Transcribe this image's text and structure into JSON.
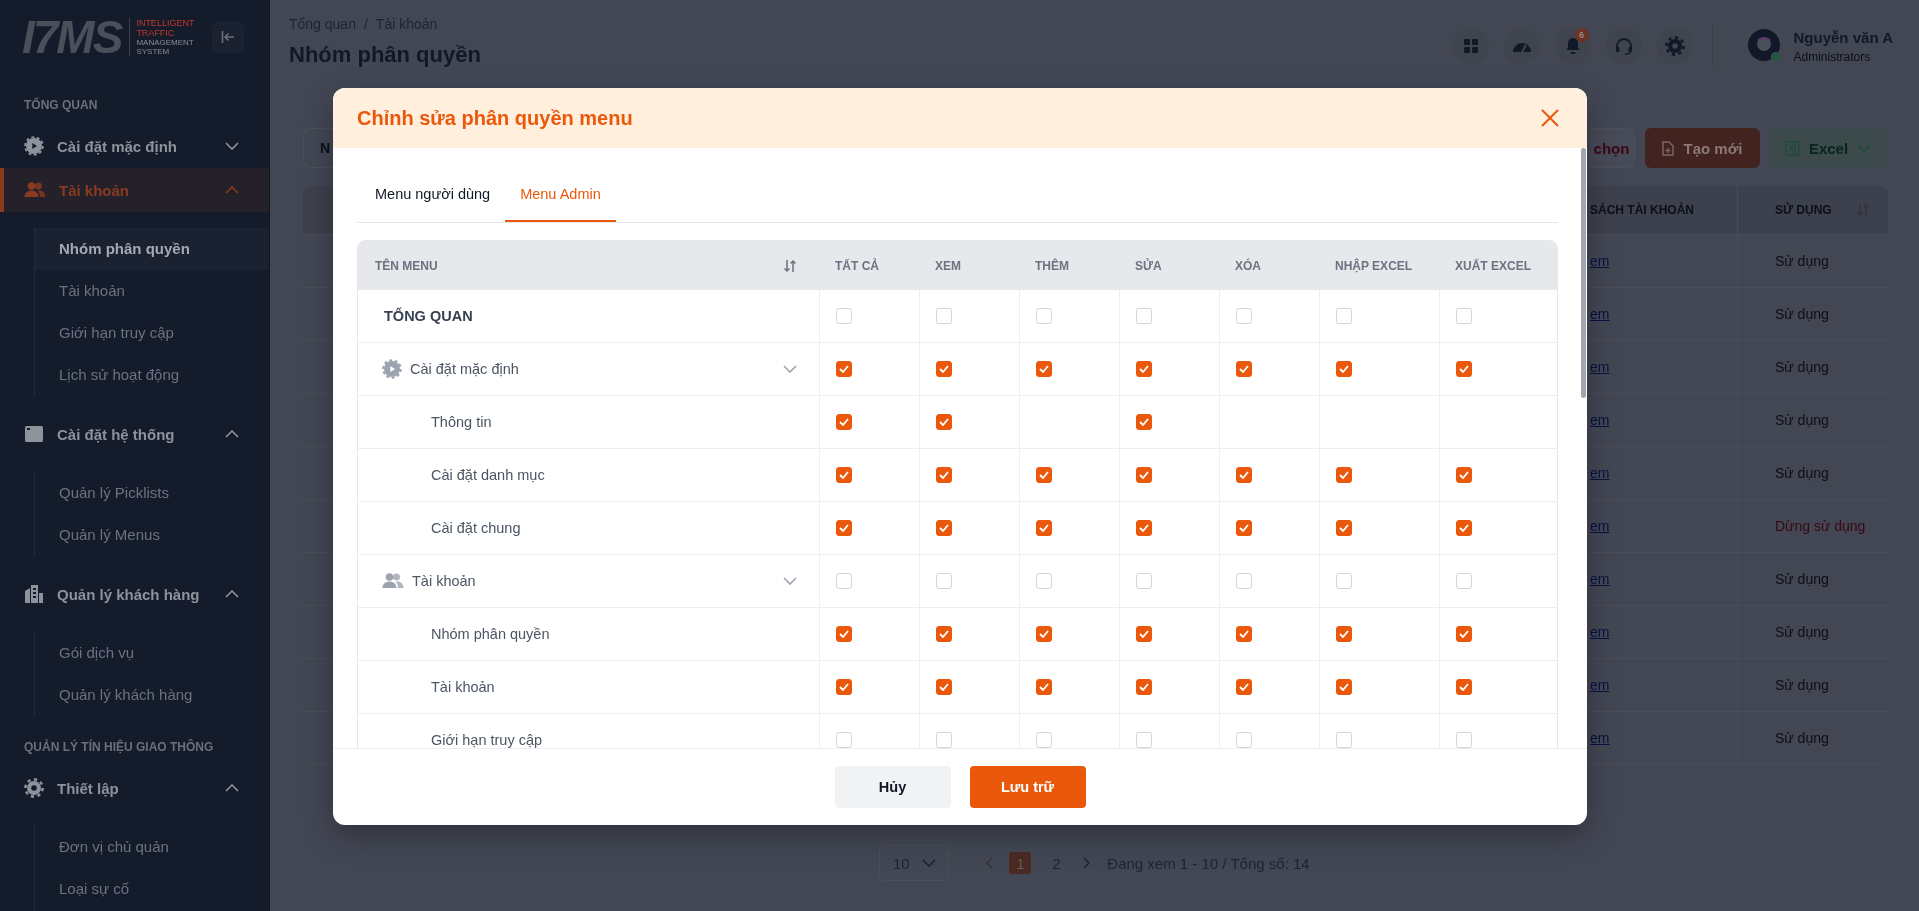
{
  "sidebar": {
    "logo": {
      "mark": "I7MS",
      "tagline": [
        {
          "text": "INTELLIGENT",
          "accent": true
        },
        {
          "text": "TRAFFIC",
          "accent": true
        },
        {
          "text": "MANAGEMENT",
          "accent": false
        },
        {
          "text": "SYSTEM",
          "accent": false
        }
      ]
    },
    "sections": [
      {
        "label": "TỔNG QUAN",
        "groups": [
          {
            "label": "Cài đặt mặc định",
            "active": false,
            "expanded": false
          },
          {
            "label": "Tài khoản",
            "active": true,
            "expanded": true,
            "items": [
              {
                "label": "Nhóm phân quyền",
                "selected": true
              },
              {
                "label": "Tài khoản",
                "selected": false
              },
              {
                "label": "Giới hạn truy cập",
                "selected": false
              },
              {
                "label": "Lịch sử hoạt động",
                "selected": false
              }
            ]
          },
          {
            "label": "Cài đặt hệ thống",
            "active": false,
            "expanded": true,
            "items": [
              {
                "label": "Quản lý Picklists",
                "selected": false
              },
              {
                "label": "Quản lý Menus",
                "selected": false
              }
            ]
          },
          {
            "label": "Quản lý khách hàng",
            "active": false,
            "expanded": true,
            "items": [
              {
                "label": "Gói dịch vụ",
                "selected": false
              },
              {
                "label": "Quản lý khách hàng",
                "selected": false
              }
            ]
          }
        ]
      },
      {
        "label": "QUẢN LÝ TÍN HIỆU GIAO THÔNG",
        "groups": [
          {
            "label": "Thiết lập",
            "active": false,
            "expanded": true,
            "items": [
              {
                "label": "Đơn vị chủ quản",
                "selected": false
              },
              {
                "label": "Loại sự cố",
                "selected": false
              }
            ]
          }
        ]
      }
    ]
  },
  "header": {
    "breadcrumb": [
      "Tổng quan",
      "Tài khoản"
    ],
    "breadcrumb_separator": "/",
    "title": "Nhóm phân quyền",
    "notifications": "6",
    "user": {
      "name": "Nguyễn văn A",
      "role": "Administrators"
    }
  },
  "toolbar": {
    "search": {
      "placeholder": "N"
    },
    "buttons": [
      {
        "kind": "danger",
        "label": "chọn"
      },
      {
        "kind": "primary",
        "label": "Tạo mới"
      },
      {
        "kind": "excel",
        "label": "Excel"
      }
    ]
  },
  "table": {
    "columns": [
      "SÁCH TÀI KHOẢN",
      "SỬ DỤNG"
    ],
    "rows": [
      {
        "link": "em",
        "status": "Sử dụng",
        "active": true
      },
      {
        "link": "em",
        "status": "Sử dụng",
        "active": true
      },
      {
        "link": "em",
        "status": "Sử dụng",
        "active": true
      },
      {
        "link": "em",
        "status": "Sử dụng",
        "active": true
      },
      {
        "link": "em",
        "status": "Sử dụng",
        "active": true
      },
      {
        "link": "em",
        "status": "Dừng sử dụng",
        "active": false
      },
      {
        "link": "em",
        "status": "Sử dụng",
        "active": true
      },
      {
        "link": "em",
        "status": "Sử dụng",
        "active": true
      },
      {
        "link": "em",
        "status": "Sử dụng",
        "active": true
      },
      {
        "link": "em",
        "status": "Sử dụng",
        "active": true
      }
    ]
  },
  "pagination": {
    "page_size": "10",
    "pages": [
      {
        "label": "1",
        "selected": true
      },
      {
        "label": "2",
        "selected": false
      }
    ],
    "summary": "Đang xem 1 - 10 / Tổng số: 14"
  },
  "modal": {
    "title": "Chỉnh sửa phân quyền menu",
    "tabs": [
      {
        "label": "Menu người dùng",
        "selected": false
      },
      {
        "label": "Menu Admin",
        "selected": true
      }
    ],
    "columns": [
      "TÊN MENU",
      "TẤT CẢ",
      "XEM",
      "THÊM",
      "SỬA",
      "XÓA",
      "NHẬP EXCEL",
      "XUẤT EXCEL"
    ],
    "rows": [
      {
        "kind": "section",
        "label": "TỔNG QUAN",
        "cells": [
          {
            "kind": "checkbox",
            "checked": false
          },
          {
            "kind": "checkbox",
            "checked": false
          },
          {
            "kind": "checkbox",
            "checked": false
          },
          {
            "kind": "checkbox",
            "checked": false
          },
          {
            "kind": "checkbox",
            "checked": false
          },
          {
            "kind": "checkbox",
            "checked": false
          },
          {
            "kind": "checkbox",
            "checked": false
          }
        ]
      },
      {
        "kind": "group",
        "label": "Cài đặt mặc định",
        "cells": [
          {
            "kind": "checkbox",
            "checked": true
          },
          {
            "kind": "checkbox",
            "checked": true
          },
          {
            "kind": "checkbox",
            "checked": true
          },
          {
            "kind": "checkbox",
            "checked": true
          },
          {
            "kind": "checkbox",
            "checked": true
          },
          {
            "kind": "checkbox",
            "checked": true
          },
          {
            "kind": "checkbox",
            "checked": true
          }
        ]
      },
      {
        "kind": "item",
        "label": "Thông tin",
        "cells": [
          {
            "kind": "checkbox",
            "checked": true
          },
          {
            "kind": "checkbox",
            "checked": true
          },
          {
            "kind": "empty"
          },
          {
            "kind": "checkbox",
            "checked": true
          },
          {
            "kind": "empty"
          },
          {
            "kind": "empty"
          },
          {
            "kind": "empty"
          }
        ]
      },
      {
        "kind": "item",
        "label": "Cài đặt danh mục",
        "cells": [
          {
            "kind": "checkbox",
            "checked": true
          },
          {
            "kind": "checkbox",
            "checked": true
          },
          {
            "kind": "checkbox",
            "checked": true
          },
          {
            "kind": "checkbox",
            "checked": true
          },
          {
            "kind": "checkbox",
            "checked": true
          },
          {
            "kind": "checkbox",
            "checked": true
          },
          {
            "kind": "checkbox",
            "checked": true
          }
        ]
      },
      {
        "kind": "item",
        "label": "Cài đặt chung",
        "cells": [
          {
            "kind": "checkbox",
            "checked": true
          },
          {
            "kind": "checkbox",
            "checked": true
          },
          {
            "kind": "checkbox",
            "checked": true
          },
          {
            "kind": "checkbox",
            "checked": true
          },
          {
            "kind": "checkbox",
            "checked": true
          },
          {
            "kind": "checkbox",
            "checked": true
          },
          {
            "kind": "checkbox",
            "checked": true
          }
        ]
      },
      {
        "kind": "group",
        "label": "Tài khoản",
        "cells": [
          {
            "kind": "checkbox",
            "checked": false
          },
          {
            "kind": "checkbox",
            "checked": false
          },
          {
            "kind": "checkbox",
            "checked": false
          },
          {
            "kind": "checkbox",
            "checked": false
          },
          {
            "kind": "checkbox",
            "checked": false
          },
          {
            "kind": "checkbox",
            "checked": false
          },
          {
            "kind": "checkbox",
            "checked": false
          }
        ]
      },
      {
        "kind": "item",
        "label": "Nhóm phân quyền",
        "cells": [
          {
            "kind": "checkbox",
            "checked": true
          },
          {
            "kind": "checkbox",
            "checked": true
          },
          {
            "kind": "checkbox",
            "checked": true
          },
          {
            "kind": "checkbox",
            "checked": true
          },
          {
            "kind": "checkbox",
            "checked": true
          },
          {
            "kind": "checkbox",
            "checked": true
          },
          {
            "kind": "checkbox",
            "checked": true
          }
        ]
      },
      {
        "kind": "item",
        "label": "Tài khoản",
        "cells": [
          {
            "kind": "checkbox",
            "checked": true
          },
          {
            "kind": "checkbox",
            "checked": true
          },
          {
            "kind": "checkbox",
            "checked": true
          },
          {
            "kind": "checkbox",
            "checked": true
          },
          {
            "kind": "checkbox",
            "checked": true
          },
          {
            "kind": "checkbox",
            "checked": true
          },
          {
            "kind": "checkbox",
            "checked": true
          }
        ]
      },
      {
        "kind": "item",
        "label": "Giới hạn truy cập",
        "cells": [
          {
            "kind": "checkbox",
            "checked": false
          },
          {
            "kind": "checkbox",
            "checked": false
          },
          {
            "kind": "checkbox",
            "checked": false
          },
          {
            "kind": "checkbox",
            "checked": false
          },
          {
            "kind": "checkbox",
            "checked": false
          },
          {
            "kind": "checkbox",
            "checked": false
          },
          {
            "kind": "checkbox",
            "checked": false
          }
        ]
      }
    ],
    "buttons": [
      {
        "kind": "secondary",
        "label": "Hủy"
      },
      {
        "kind": "primary",
        "label": "Lưu trữ"
      }
    ]
  }
}
